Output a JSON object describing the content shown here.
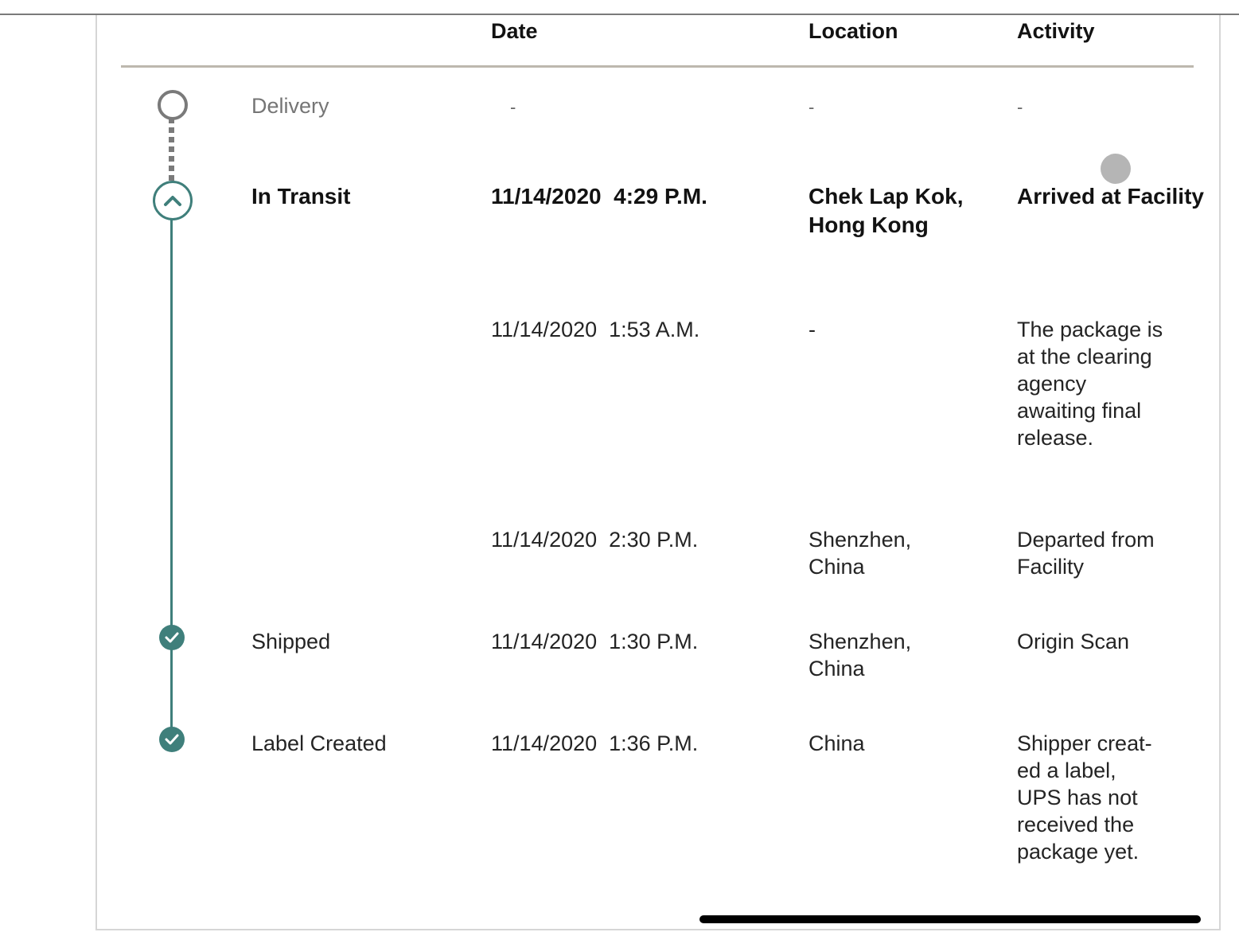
{
  "headers": {
    "date": "Date",
    "location": "Location",
    "activity": "Activity"
  },
  "rows": [
    {
      "status": "Delivery",
      "date": "-",
      "location": "-",
      "activity": "-"
    },
    {
      "status": "In Transit",
      "date": "11/14/2020  4:29 P.M.",
      "location": "Chek Lap Kok, Hong Kong",
      "activity": "Arrived at Facility"
    },
    {
      "status": "",
      "date": "11/14/2020  1:53 A.M.",
      "location": "-",
      "activity": "The package is at the clearing agency awaiting final release."
    },
    {
      "status": "",
      "date": "11/14/2020  2:30 P.M.",
      "location": "Shenzhen, China",
      "activity": "Departed from Facility"
    },
    {
      "status": "Shipped",
      "date": "11/14/2020  1:30 P.M.",
      "location": "Shenzhen, China",
      "activity": "Origin Scan"
    },
    {
      "status": "Label Created",
      "date": "11/14/2020  1:36 P.M.",
      "location": "China",
      "activity": "Shipper creat-ed a label, UPS has not received the package yet."
    }
  ],
  "colors": {
    "accent": "#3f7f7b",
    "pending": "#7a7a7a",
    "rule": "#bdb8ae"
  },
  "icons": {
    "current": "chevron-up-icon",
    "done": "checkmark-icon",
    "pending": "empty-circle-icon"
  }
}
